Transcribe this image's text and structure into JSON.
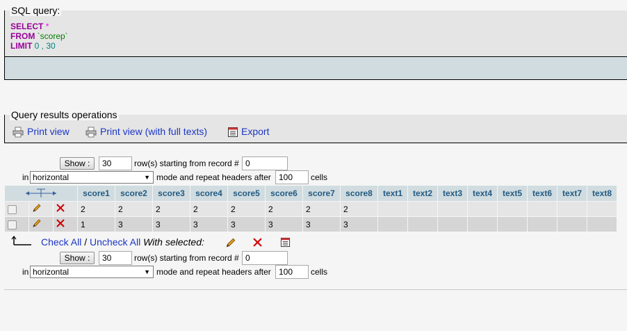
{
  "sql_section": {
    "legend": "SQL query:",
    "line1_kw": "SELECT",
    "line1_sym": "*",
    "line2_kw": "FROM",
    "line2_str": "`scorep`",
    "line3_kw": "LIMIT",
    "line3_num": "0 , 30"
  },
  "ops_section": {
    "legend": "Query results operations",
    "print_view": "Print view",
    "print_view_full": "Print view (with full texts)",
    "export": "Export"
  },
  "nav": {
    "show_label": "Show :",
    "rows_value": "30",
    "rows_text": "row(s) starting from record #",
    "start_value": "0",
    "in_text": "in",
    "mode_value": "horizontal",
    "mode_text": "mode and repeat headers after",
    "repeat_value": "100",
    "cells_text": "cells"
  },
  "table": {
    "columns": [
      "score1",
      "score2",
      "score3",
      "score4",
      "score5",
      "score6",
      "score7",
      "score8",
      "text1",
      "text2",
      "text3",
      "text4",
      "text5",
      "text6",
      "text7",
      "text8"
    ],
    "rows": [
      [
        "2",
        "2",
        "2",
        "2",
        "2",
        "2",
        "2",
        "2",
        "",
        "",
        "",
        "",
        "",
        "",
        "",
        ""
      ],
      [
        "1",
        "3",
        "3",
        "3",
        "3",
        "3",
        "3",
        "3",
        "",
        "",
        "",
        "",
        "",
        "",
        "",
        ""
      ]
    ]
  },
  "bulk": {
    "check_all": "Check All",
    "separator": "/",
    "uncheck_all": "Uncheck All",
    "with_selected": "With selected:"
  },
  "icons": {
    "print": "printer-icon",
    "export": "export-icon",
    "edit": "pencil-icon",
    "delete": "delete-x-icon",
    "arrow": "arrow-up-left-icon",
    "sort": "column-sort-arrows-icon"
  },
  "colors": {
    "link": "#1a35c5",
    "header_text": "#235a81",
    "header_bg": "#d0dce0",
    "keyword": "#990099",
    "delete": "#cc0000"
  }
}
